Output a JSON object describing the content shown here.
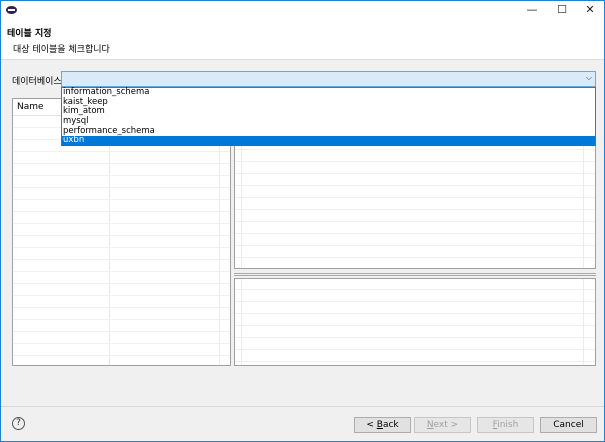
{
  "window": {
    "min_glyph": "—",
    "max_glyph": "☐",
    "close_glyph": "✕"
  },
  "banner": {
    "title": "테이블 지정",
    "description": "대상 테이블을 체크합니다"
  },
  "database": {
    "label": "데이터베이스",
    "value": "",
    "options": [
      "information_schema",
      "kaist_keep",
      "kim_atom",
      "mysql",
      "performance_schema",
      "uxbn"
    ],
    "selected_index": 5
  },
  "table_list": {
    "column_name": "Name"
  },
  "footer": {
    "help_glyph": "?",
    "back_mnemonic": "B",
    "back_rest": "ack",
    "back_prefix": "< ",
    "next_mnemonic": "N",
    "next_rest": "ext >",
    "finish_mnemonic": "F",
    "finish_rest": "inish",
    "cancel_label": "Cancel"
  },
  "colors": {
    "accent": "#0078d7",
    "combo_bg": "#dbeaf8",
    "window_border": "#1883d7"
  }
}
